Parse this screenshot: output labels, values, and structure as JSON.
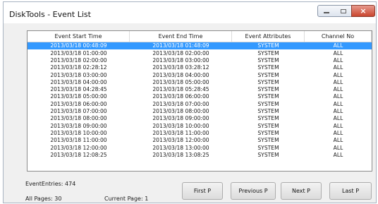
{
  "window": {
    "title": "DiskTools - Event List",
    "close_glyph": "×"
  },
  "table": {
    "columns": [
      "Event Start Time",
      "Event End Time",
      "Event Attributes",
      "Channel No"
    ],
    "selected_row": 0,
    "rows": [
      [
        "2013/03/18 00:48:09",
        "2013/03/18 01:48:09",
        "SYSTEM",
        "ALL"
      ],
      [
        "2013/03/18 01:00:00",
        "2013/03/18 02:00:00",
        "SYSTEM",
        "ALL"
      ],
      [
        "2013/03/18 02:00:00",
        "2013/03/18 03:00:00",
        "SYSTEM",
        "ALL"
      ],
      [
        "2013/03/18 02:28:12",
        "2013/03/18 03:28:12",
        "SYSTEM",
        "ALL"
      ],
      [
        "2013/03/18 03:00:00",
        "2013/03/18 04:00:00",
        "SYSTEM",
        "ALL"
      ],
      [
        "2013/03/18 04:00:00",
        "2013/03/18 05:00:00",
        "SYSTEM",
        "ALL"
      ],
      [
        "2013/03/18 04:28:45",
        "2013/03/18 05:28:45",
        "SYSTEM",
        "ALL"
      ],
      [
        "2013/03/18 05:00:00",
        "2013/03/18 06:00:00",
        "SYSTEM",
        "ALL"
      ],
      [
        "2013/03/18 06:00:00",
        "2013/03/18 07:00:00",
        "SYSTEM",
        "ALL"
      ],
      [
        "2013/03/18 07:00:00",
        "2013/03/18 08:00:00",
        "SYSTEM",
        "ALL"
      ],
      [
        "2013/03/18 08:00:00",
        "2013/03/18 09:00:00",
        "SYSTEM",
        "ALL"
      ],
      [
        "2013/03/18 09:00:00",
        "2013/03/18 10:00:00",
        "SYSTEM",
        "ALL"
      ],
      [
        "2013/03/18 10:00:00",
        "2013/03/18 11:00:00",
        "SYSTEM",
        "ALL"
      ],
      [
        "2013/03/18 11:00:00",
        "2013/03/18 12:00:00",
        "SYSTEM",
        "ALL"
      ],
      [
        "2013/03/18 12:00:00",
        "2013/03/18 13:00:00",
        "SYSTEM",
        "ALL"
      ],
      [
        "2013/03/18 12:08:25",
        "2013/03/18 13:08:25",
        "SYSTEM",
        "ALL"
      ]
    ]
  },
  "footer": {
    "event_entries": "EventEntries: 474",
    "all_pages": "All Pages: 30",
    "current_page": "Current Page: 1",
    "buttons": {
      "first": "First P",
      "previous": "Previous P",
      "next": "Next P",
      "last": "Last  P"
    }
  }
}
